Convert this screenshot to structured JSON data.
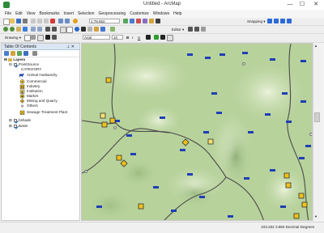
{
  "window": {
    "title": "Untitled - ArcMap",
    "min": "—",
    "max": "☐",
    "close": "✕"
  },
  "menu": [
    "File",
    "Edit",
    "View",
    "Bookmarks",
    "Insert",
    "Selection",
    "Geoprocessing",
    "Customize",
    "Windows",
    "Help"
  ],
  "toolbar1": {
    "scale": "1:78,652",
    "snapping_label": "Snapping ▾"
  },
  "toolbar2": {
    "editor_label": "Editor ▾"
  },
  "toolbar3": {
    "drawing_label": "Drawing ▾",
    "font": "Arial",
    "font_size": "10",
    "bold": "B",
    "italic": "I",
    "underline": "U"
  },
  "toc": {
    "title": "Table Of Contents",
    "pin": "⊥ ✕",
    "layers_label": "Layers",
    "point_layer": "PointSource",
    "field_label": "CATEGORY",
    "categories": [
      "Animal Husbandry",
      "Commercial",
      "Industry",
      "Institution",
      "Market",
      "Mining and Quarry",
      "Others",
      "Sewage Treatment Plant"
    ],
    "layer_2": "hshade",
    "layer_3": "Basin"
  },
  "status": {
    "coords": "103.252  3.883 Decimal Degrees"
  },
  "colors": {
    "map_bg": "#b8d29c",
    "cow_blue": "#1e3fb5",
    "industry_yellow": "#f0c21a",
    "basin_line": "#4a4a4a"
  }
}
